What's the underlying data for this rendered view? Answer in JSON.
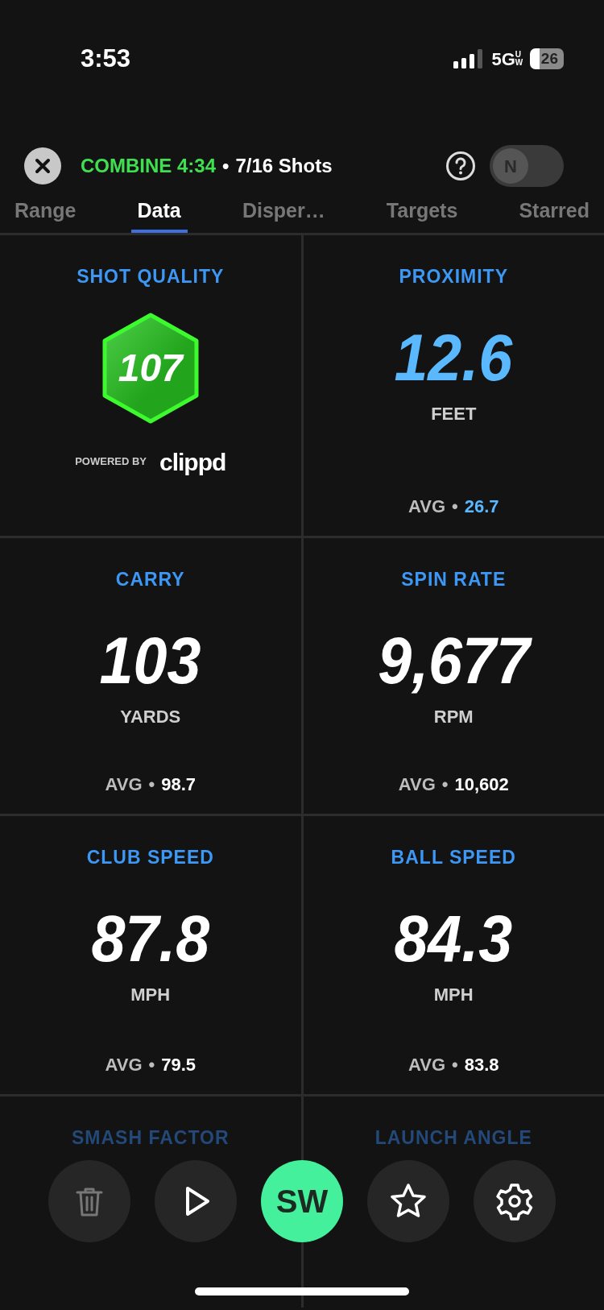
{
  "status_bar": {
    "time": "3:53",
    "network": "5G",
    "network_sub": "UW",
    "battery": "26"
  },
  "header": {
    "mode": "COMBINE 4:34",
    "separator": "•",
    "shots": "7/16 Shots",
    "toggle": {
      "label": "N",
      "on": false
    }
  },
  "tabs": [
    {
      "label": "Range",
      "selected": false
    },
    {
      "label": "Data",
      "selected": true
    },
    {
      "label": "Disper…",
      "selected": false
    },
    {
      "label": "Targets",
      "selected": false
    },
    {
      "label": "Starred",
      "selected": false
    }
  ],
  "cells": [
    {
      "kind": "quality",
      "title": "SHOT QUALITY",
      "value": "107",
      "powered_by": "POWERED BY",
      "brand": "clippd"
    },
    {
      "kind": "metric",
      "title": "PROXIMITY",
      "value": "12.6",
      "unit": "FEET",
      "avg_label": "AVG",
      "separator": "•",
      "avg_value": "26.7",
      "accent": true
    },
    {
      "kind": "metric",
      "title": "CARRY",
      "value": "103",
      "unit": "YARDS",
      "avg_label": "AVG",
      "separator": "•",
      "avg_value": "98.7",
      "accent": false
    },
    {
      "kind": "metric",
      "title": "SPIN RATE",
      "value": "9,677",
      "unit": "RPM",
      "avg_label": "AVG",
      "separator": "•",
      "avg_value": "10,602",
      "accent": false
    },
    {
      "kind": "metric",
      "title": "CLUB SPEED",
      "value": "87.8",
      "unit": "MPH",
      "avg_label": "AVG",
      "separator": "•",
      "avg_value": "79.5",
      "accent": false
    },
    {
      "kind": "metric",
      "title": "BALL SPEED",
      "value": "84.3",
      "unit": "MPH",
      "avg_label": "AVG",
      "separator": "•",
      "avg_value": "83.8",
      "accent": false
    },
    {
      "kind": "partial",
      "title": "SMASH FACTOR"
    },
    {
      "kind": "partial",
      "title": "LAUNCH ANGLE"
    }
  ],
  "actions": [
    {
      "kind": "trash"
    },
    {
      "kind": "play"
    },
    {
      "kind": "club",
      "label": "SW"
    },
    {
      "kind": "star"
    },
    {
      "kind": "gear"
    }
  ]
}
